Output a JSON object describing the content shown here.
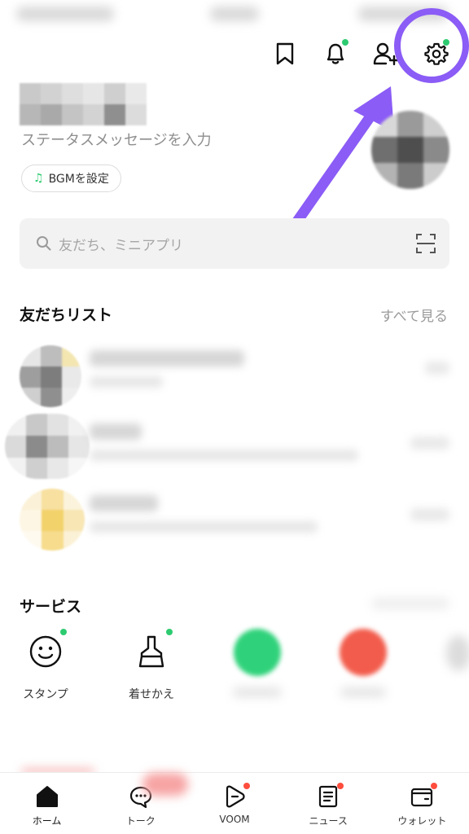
{
  "header": {
    "icons": [
      "bookmark-icon",
      "bell-icon",
      "add-friend-icon",
      "gear-icon"
    ]
  },
  "profile": {
    "status_message": "ステータスメッセージを入力",
    "bgm_label": "BGMを設定"
  },
  "search": {
    "placeholder": "友だち、ミニアプリ"
  },
  "friends": {
    "title": "友だちリスト",
    "see_all": "すべて見る"
  },
  "services": {
    "title": "サービス",
    "items": [
      {
        "label": "スタンプ",
        "icon": "smile-icon"
      },
      {
        "label": "着せかえ",
        "icon": "brush-icon"
      }
    ]
  },
  "tabbar": {
    "tabs": [
      {
        "label": "ホーム",
        "icon": "home-icon"
      },
      {
        "label": "トーク",
        "icon": "chat-icon"
      },
      {
        "label": "VOOM",
        "icon": "voom-icon"
      },
      {
        "label": "ニュース",
        "icon": "news-icon"
      },
      {
        "label": "ウォレット",
        "icon": "wallet-icon"
      }
    ]
  },
  "colors": {
    "accent_green": "#2dcb70",
    "badge_red": "#ff4d3d",
    "highlight_purple": "#8b5cf6"
  }
}
